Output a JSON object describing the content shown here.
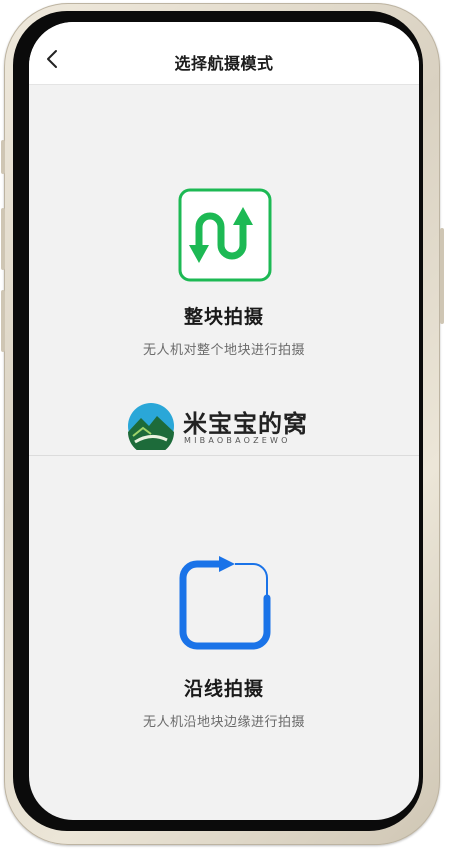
{
  "nav": {
    "title": "选择航摄模式",
    "back_icon": "chevron-left-icon"
  },
  "options": [
    {
      "id": "block",
      "icon": "zigzag-arrows-icon",
      "icon_color": "#1db954",
      "title": "整块拍摄",
      "description": "无人机对整个地块进行拍摄"
    },
    {
      "id": "line",
      "icon": "loop-arrow-square-icon",
      "icon_color": "#1a73e8",
      "title": "沿线拍摄",
      "description": "无人机沿地块边缘进行拍摄"
    }
  ],
  "watermark": {
    "name": "米宝宝的窝",
    "subtitle": "MIBAOBAOZEWO"
  },
  "colors": {
    "background": "#f2f2f2",
    "nav_background": "#ffffff",
    "block_accent": "#1db954",
    "line_accent": "#1a73e8"
  }
}
